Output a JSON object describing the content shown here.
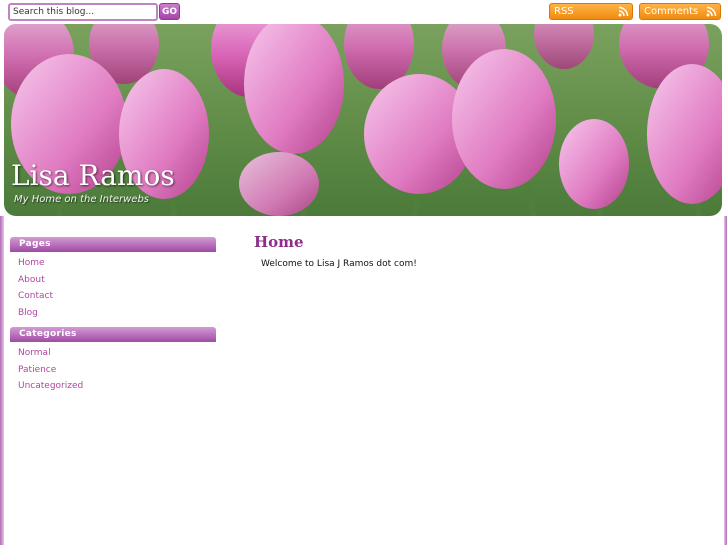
{
  "search": {
    "placeholder": "Search this blog...",
    "go_label": "GO"
  },
  "feeds": {
    "rss_label": "RSS",
    "comments_label": "Comments"
  },
  "header": {
    "title": "Lisa Ramos",
    "tagline": "My Home on the Interwebs"
  },
  "sidebar": {
    "pages_title": "Pages",
    "pages": [
      {
        "label": "Home"
      },
      {
        "label": "About"
      },
      {
        "label": "Contact"
      },
      {
        "label": "Blog"
      }
    ],
    "categories_title": "Categories",
    "categories": [
      {
        "label": "Normal"
      },
      {
        "label": "Patience"
      },
      {
        "label": "Uncategorized"
      }
    ]
  },
  "main": {
    "title": "Home",
    "body": "Welcome to Lisa J Ramos dot com!"
  },
  "colors": {
    "accent": "#8d2e89",
    "link": "#b0479f",
    "feed": "#f08a10"
  }
}
